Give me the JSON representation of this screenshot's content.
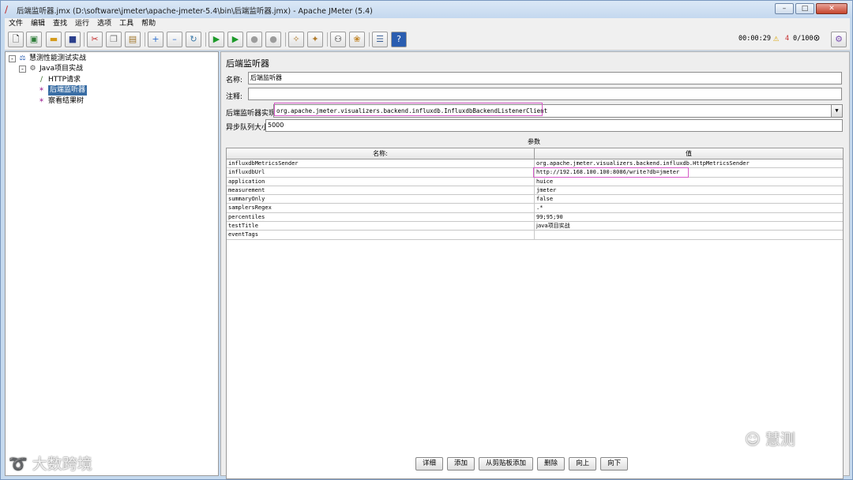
{
  "window": {
    "title": "后端监听器.jmx (D:\\software\\jmeter\\apache-jmeter-5.4\\bin\\后端监听器.jmx) - Apache JMeter (5.4)",
    "controls": [
      "minimize",
      "maximize",
      "close"
    ]
  },
  "menubar": {
    "items": [
      "文件",
      "编辑",
      "查找",
      "运行",
      "选项",
      "工具",
      "帮助"
    ]
  },
  "toolbar": {
    "icons": [
      "new-icon",
      "templates-icon",
      "open-icon",
      "save-icon",
      "cut-icon",
      "copy-icon",
      "paste-icon",
      "expand-icon",
      "collapse-icon",
      "toggle-icon",
      "start-icon",
      "start-no-pause-icon",
      "stop-icon",
      "shutdown-icon",
      "clear-icon",
      "clear-all-icon",
      "search-icon",
      "reset-search-icon",
      "function-helper-icon",
      "help-icon"
    ],
    "timer": "00:00:29",
    "warning_count": "4",
    "threads": "0/100"
  },
  "tree": {
    "nodes": [
      {
        "label": "慧测性能测试实战",
        "icon": "test-plan-icon",
        "toggle": "-"
      },
      {
        "label": "Java项目实战",
        "icon": "thread-group-icon",
        "toggle": "-"
      },
      {
        "label": "HTTP请求",
        "icon": "sampler-icon"
      },
      {
        "label": "后端监听器",
        "icon": "listener-icon",
        "selected": true
      },
      {
        "label": "察看结果树",
        "icon": "listener-icon"
      }
    ]
  },
  "panel": {
    "title": "后端监听器",
    "name_label": "名称:",
    "name_value": "后端监听器",
    "comment_label": "注释:",
    "comment_value": "",
    "impl_label": "后端监听器实现",
    "impl_value": "org.apache.jmeter.visualizers.backend.influxdb.InfluxdbBackendListenerClient",
    "queue_label": "异步队列大小",
    "queue_value": "5000",
    "params_title": "参数",
    "col_name": "名称:",
    "col_value": "值",
    "rows": [
      {
        "name": "influxdbMetricsSender",
        "value": "org.apache.jmeter.visualizers.backend.influxdb.HttpMetricsSender"
      },
      {
        "name": "influxdbUrl",
        "value": "http://192.168.100.100:8086/write?db=jmeter"
      },
      {
        "name": "application",
        "value": "huice"
      },
      {
        "name": "measurement",
        "value": "jmeter"
      },
      {
        "name": "summaryOnly",
        "value": "false"
      },
      {
        "name": "samplersRegex",
        "value": ".*"
      },
      {
        "name": "percentiles",
        "value": "99;95;90"
      },
      {
        "name": "testTitle",
        "value": "java项目实战"
      },
      {
        "name": "eventTags",
        "value": ""
      }
    ]
  },
  "buttons": {
    "detail": "详细",
    "add": "添加",
    "add_clipboard": "从剪贴板添加",
    "delete": "删除",
    "up": "向上",
    "down": "向下"
  },
  "watermarks": {
    "left": "大数跨境",
    "right": "慧测"
  },
  "colors": {
    "highlight": "#d65cc8",
    "selection": "#3a6ea5",
    "window_frame": "#c5d9ee"
  }
}
